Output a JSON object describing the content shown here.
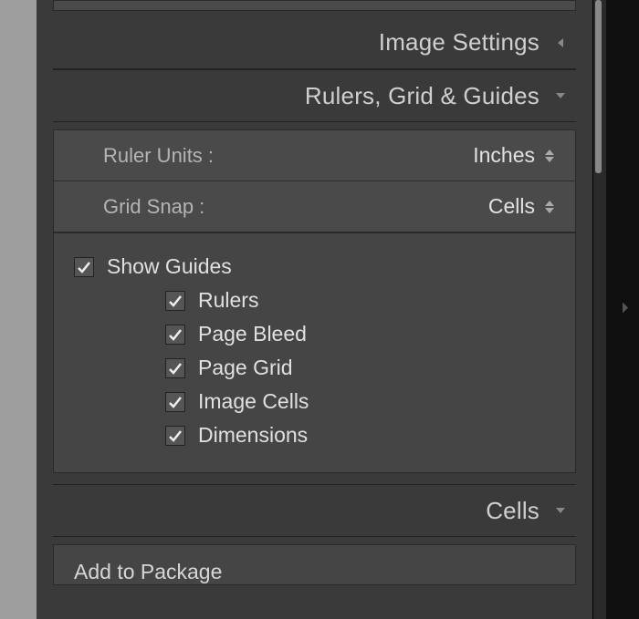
{
  "sections": {
    "imageSettings": {
      "title": "Image Settings"
    },
    "rulersGridGuides": {
      "title": "Rulers, Grid & Guides",
      "rulerUnits": {
        "label": "Ruler Units :",
        "value": "Inches"
      },
      "gridSnap": {
        "label": "Grid Snap :",
        "value": "Cells"
      },
      "showGuides": {
        "label": "Show Guides",
        "checked": true
      },
      "subGuides": {
        "rulers": {
          "label": "Rulers",
          "checked": true
        },
        "pageBleed": {
          "label": "Page Bleed",
          "checked": true
        },
        "pageGrid": {
          "label": "Page Grid",
          "checked": true
        },
        "imageCells": {
          "label": "Image Cells",
          "checked": true
        },
        "dimensions": {
          "label": "Dimensions",
          "checked": true
        }
      }
    },
    "cells": {
      "title": "Cells",
      "addToPackage": "Add to Package"
    }
  }
}
